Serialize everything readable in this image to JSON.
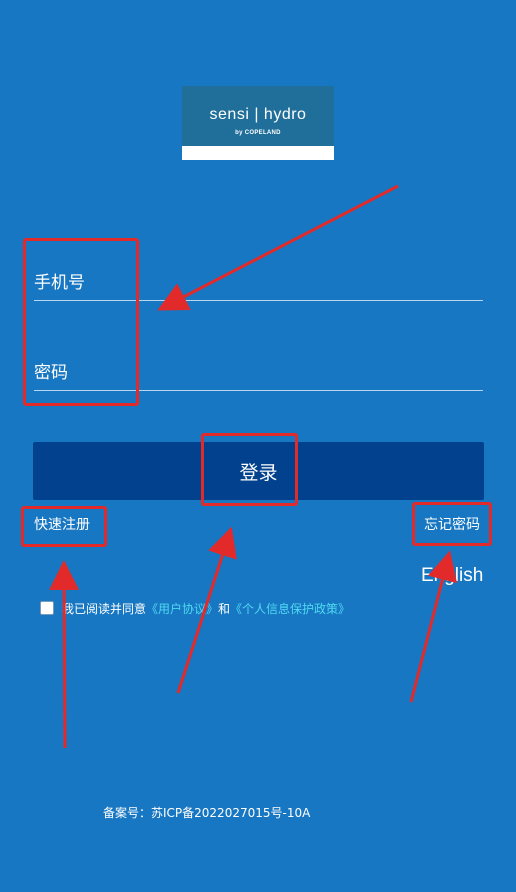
{
  "logo": {
    "brand": "sensi | hydro",
    "sub": "by COPELAND"
  },
  "form": {
    "phone_placeholder": "手机号",
    "password_placeholder": "密码",
    "login_label": "登录"
  },
  "links": {
    "quick_register": "快速注册",
    "forgot_password": "忘记密码",
    "language": "English"
  },
  "agreement": {
    "prefix": "我已阅读并同意",
    "user_agreement": "《用户协议》",
    "conjunction": "和",
    "privacy_policy": "《个人信息保护政策》",
    "checked": false
  },
  "footer": {
    "icp": "备案号：苏ICP备2022027015号-10A"
  },
  "colors": {
    "background": "#1877c2",
    "button": "#02418d",
    "link": "#4fd9f2",
    "annotation": "#e22a2a"
  }
}
